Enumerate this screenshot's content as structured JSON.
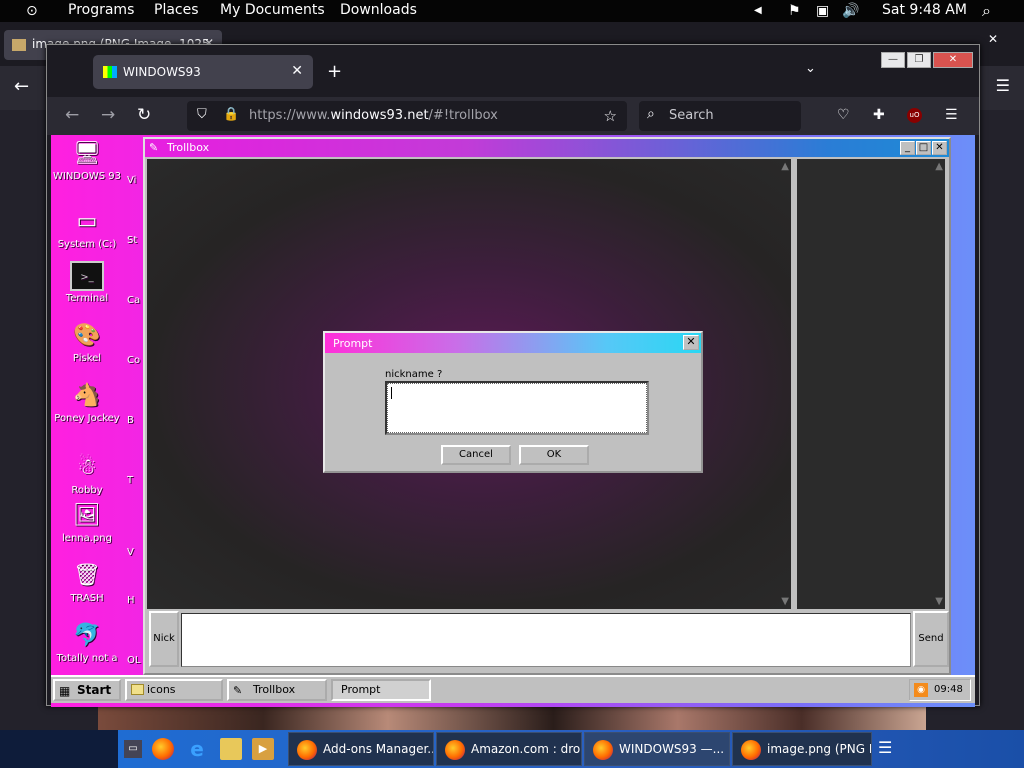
{
  "top_panel": {
    "menus": [
      "Programs",
      "Places",
      "My Documents",
      "Downloads"
    ],
    "clock": "Sat 9:48 AM"
  },
  "bg_window": {
    "tab_title": "image.png (PNG Image, 1025…"
  },
  "browser": {
    "tab_title": "WINDOWS93",
    "url_dim_prefix": "https://www.",
    "url_domain": "windows93.net",
    "url_rest": "/#!trollbox",
    "search_placeholder": "Search",
    "ublock_badge": "uO"
  },
  "desktop": {
    "icons": [
      {
        "label": "WINDOWS 93",
        "side": "Vi"
      },
      {
        "label": "System (C:)",
        "side": "St"
      },
      {
        "label": "Terminal",
        "side": "Ca"
      },
      {
        "label": "Piskel",
        "side": "Co"
      },
      {
        "label": "Poney Jockey",
        "side": "B"
      },
      {
        "label": "Robby",
        "side": "T"
      },
      {
        "label": "lenna.png",
        "side": "V"
      },
      {
        "label": "TRASH",
        "side": "H"
      },
      {
        "label": "Totally not a",
        "side": "OL"
      }
    ]
  },
  "trollbox": {
    "title": "Trollbox",
    "nick_button": "Nick",
    "send_button": "Send"
  },
  "prompt": {
    "title": "Prompt",
    "label": "nickname ?",
    "input_value": "",
    "cancel": "Cancel",
    "ok": "OK"
  },
  "w93_taskbar": {
    "start": "Start",
    "tasks": [
      "icons",
      "Trollbox",
      "Prompt"
    ],
    "clock": "09:48"
  },
  "os_taskbar": {
    "tasks": [
      "Add-ons Manager...",
      "Amazon.com : dro...",
      "WINDOWS93 —...",
      "image.png (PNG I..."
    ]
  },
  "colors": {
    "desktop_gradient_start": "#ff1fe0",
    "desktop_gradient_end": "#6c8ff9",
    "w93_chrome": "#c0c0c0",
    "firefox_dark": "#2b2a33"
  }
}
